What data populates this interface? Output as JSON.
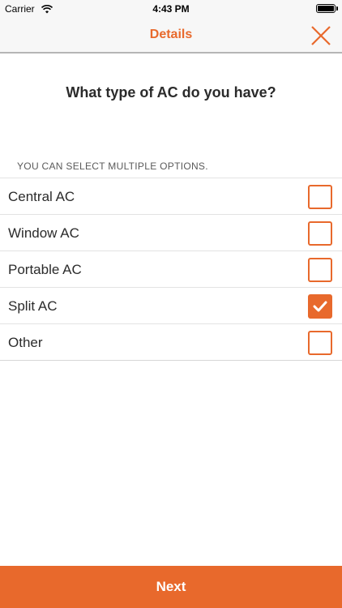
{
  "status_bar": {
    "carrier": "Carrier",
    "time": "4:43 PM",
    "wifi_icon": "wifi-icon",
    "battery_icon": "battery-icon"
  },
  "nav": {
    "title": "Details",
    "close_icon": "close-icon"
  },
  "question": "What type of AC do you have?",
  "hint": "YOU CAN SELECT MULTIPLE OPTIONS.",
  "options": [
    {
      "label": "Central AC",
      "checked": false
    },
    {
      "label": "Window AC",
      "checked": false
    },
    {
      "label": "Portable AC",
      "checked": false
    },
    {
      "label": "Split AC",
      "checked": true
    },
    {
      "label": "Other",
      "checked": false
    }
  ],
  "next_label": "Next",
  "colors": {
    "accent": "#e8692c",
    "text": "#2b2b2b",
    "nav_background": "#f7f7f7"
  }
}
